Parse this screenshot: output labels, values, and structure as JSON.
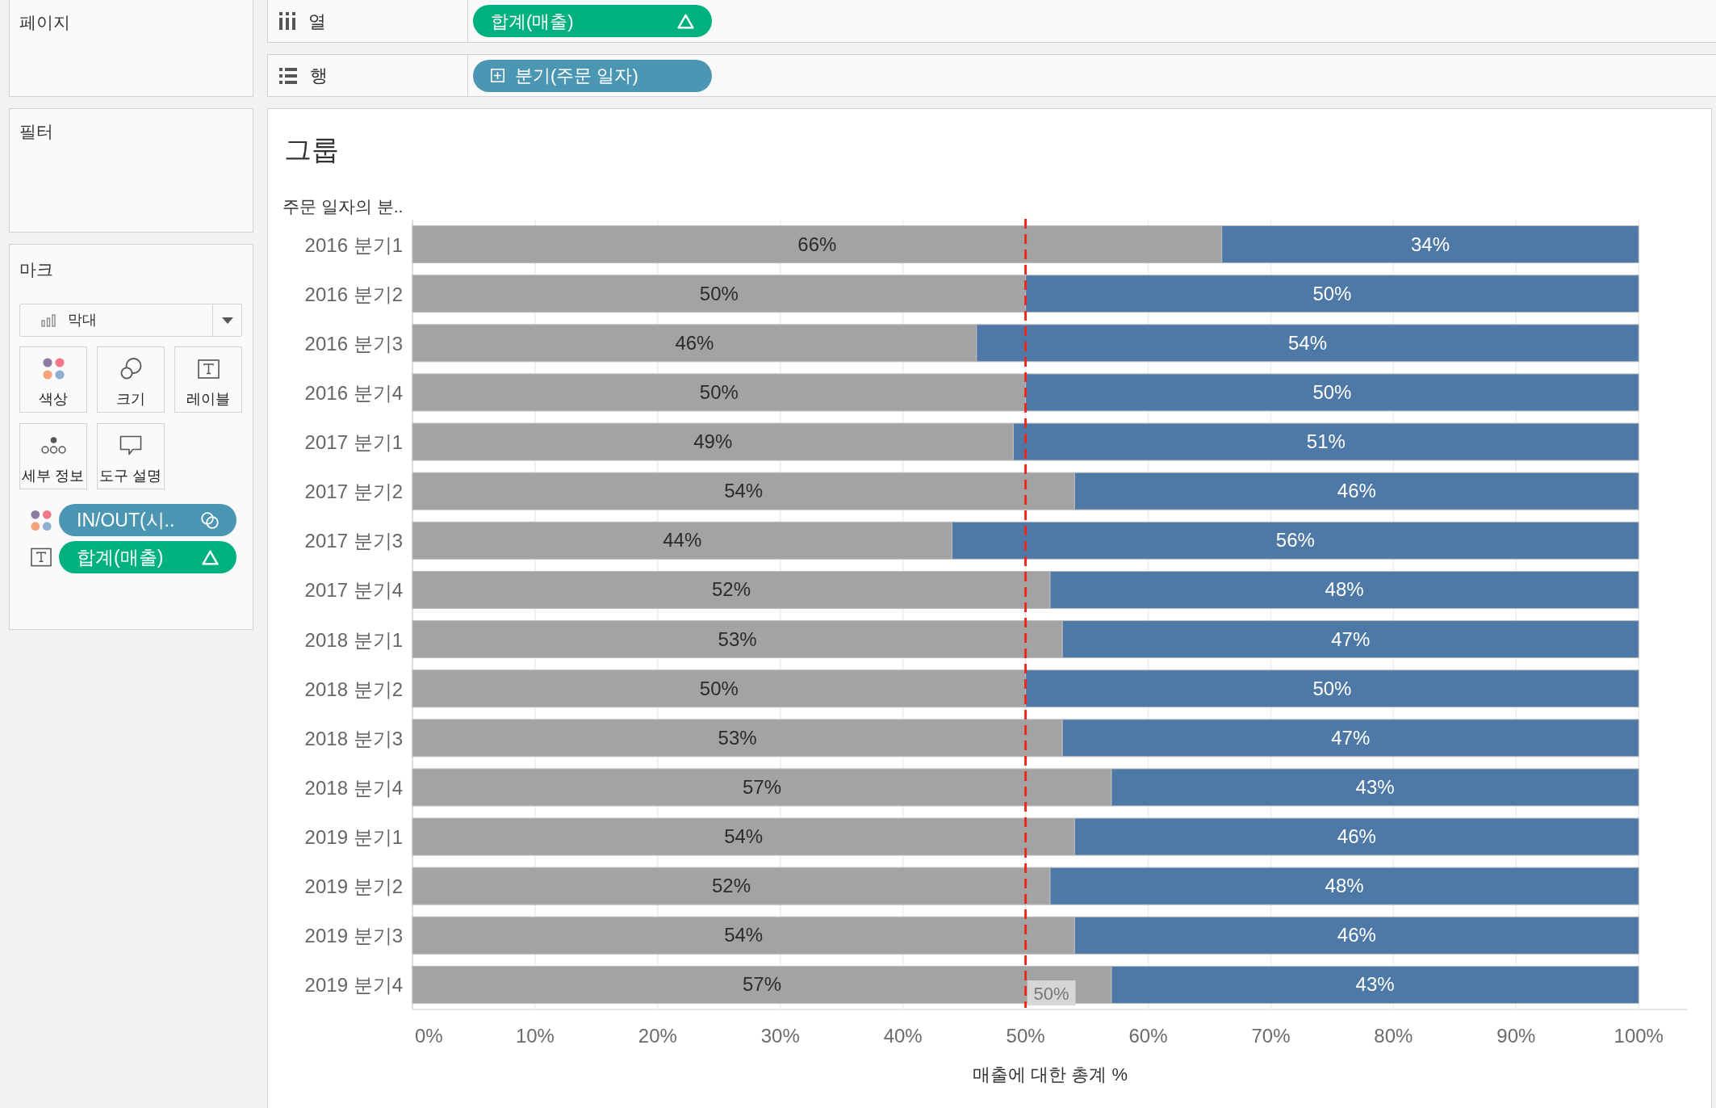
{
  "left_panel": {
    "pages": {
      "title": "페이지"
    },
    "filters": {
      "title": "필터"
    },
    "marks": {
      "title": "마크",
      "mark_type": {
        "value": "막대"
      },
      "cards": [
        {
          "kind": "color",
          "label": "색상"
        },
        {
          "kind": "size",
          "label": "크기"
        },
        {
          "kind": "label",
          "label": "레이블"
        },
        {
          "kind": "detail",
          "label": "세부 정보"
        },
        {
          "kind": "tooltip",
          "label": "도구 설명"
        }
      ],
      "fields": [
        {
          "kind": "color",
          "pill": {
            "label": "IN/OUT(시..",
            "color": "#4a96b3",
            "kind": "set"
          }
        },
        {
          "kind": "label",
          "pill": {
            "label": "합계(매출)",
            "color": "#00b180",
            "kind": "table-calc"
          }
        }
      ]
    }
  },
  "shelves": [
    {
      "kind": "columns",
      "label": "열",
      "pills": [
        {
          "label": "합계(매출)",
          "color": "#00b180",
          "kind": "table-calc"
        }
      ]
    },
    {
      "kind": "rows",
      "label": "행",
      "pills": [
        {
          "label": "분기(주문 일자)",
          "color": "#4a96b3",
          "kind": "drill"
        }
      ]
    }
  ],
  "view": {
    "chart_data": [
      {
        "type": "bar",
        "orientation": "horizontal",
        "stacked": true,
        "title": "그룹",
        "ylabel": "주문 일자의 분..",
        "xlabel": "매출에 대한 총계 %",
        "categories": [
          "2016 분기1",
          "2016 분기2",
          "2016 분기3",
          "2016 분기4",
          "2017 분기1",
          "2017 분기2",
          "2017 분기3",
          "2017 분기4",
          "2018 분기1",
          "2018 분기2",
          "2018 분기3",
          "2018 분기4",
          "2019 분기1",
          "2019 분기2",
          "2019 분기3",
          "2019 분기4"
        ],
        "series": [
          {
            "color": "#a3a3a3",
            "values": [
              66,
              50,
              46,
              50,
              49,
              54,
              44,
              52,
              53,
              50,
              53,
              57,
              54,
              52,
              54,
              57
            ],
            "value_labels": [
              "66%",
              "50%",
              "46%",
              "50%",
              "49%",
              "54%",
              "44%",
              "52%",
              "53%",
              "50%",
              "53%",
              "57%",
              "54%",
              "52%",
              "54%",
              "57%"
            ]
          },
          {
            "color": "#4e79a7",
            "values": [
              34,
              50,
              54,
              50,
              51,
              46,
              56,
              48,
              47,
              50,
              47,
              43,
              46,
              48,
              46,
              43
            ],
            "value_labels": [
              "34%",
              "50%",
              "54%",
              "50%",
              "51%",
              "46%",
              "56%",
              "48%",
              "47%",
              "50%",
              "47%",
              "43%",
              "46%",
              "48%",
              "46%",
              "43%"
            ]
          }
        ],
        "data_labels": true,
        "grid": true,
        "xlim": [
          0,
          104
        ],
        "xticks": [
          {
            "value": 0,
            "label": "0%"
          },
          {
            "value": 10,
            "label": "10%"
          },
          {
            "value": 20,
            "label": "20%"
          },
          {
            "value": 30,
            "label": "30%"
          },
          {
            "value": 40,
            "label": "40%"
          },
          {
            "value": 50,
            "label": "50%"
          },
          {
            "value": 60,
            "label": "60%"
          },
          {
            "value": 70,
            "label": "70%"
          },
          {
            "value": 80,
            "label": "80%"
          },
          {
            "value": 90,
            "label": "90%"
          },
          {
            "value": 100,
            "label": "100%"
          }
        ],
        "ref_lines": [
          {
            "axis": "x",
            "value": 50,
            "label": "50%",
            "color": "#e8291c",
            "line_style": "dashed"
          }
        ]
      }
    ]
  }
}
